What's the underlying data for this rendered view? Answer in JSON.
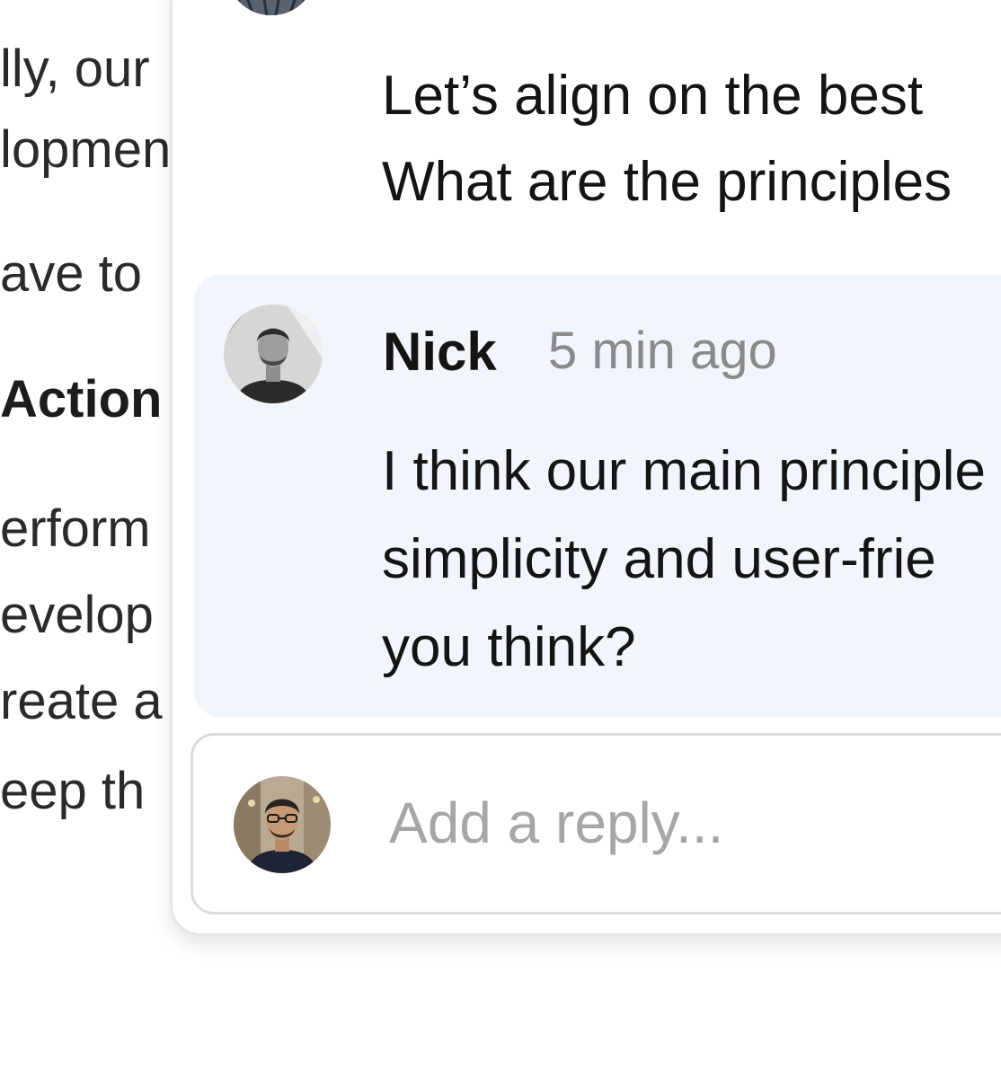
{
  "document": {
    "lines": [
      "lly, our",
      "lopment",
      "ave to",
      "Action",
      "erform",
      "evelop",
      "reate a",
      "eep th"
    ]
  },
  "comments": {
    "previous": {
      "body_lines": [
        "Let’s align on the best",
        "What are the principles"
      ]
    },
    "active": {
      "author": "Nick",
      "time": "5 min ago",
      "body_lines": [
        "I think our main principle",
        "simplicity and user-frie",
        "you think?"
      ]
    }
  },
  "reply": {
    "placeholder": "Add a reply..."
  },
  "colors": {
    "active_bg": "#f1f6fd",
    "muted_text": "#8a8a8a",
    "placeholder": "#a6a6a6"
  }
}
